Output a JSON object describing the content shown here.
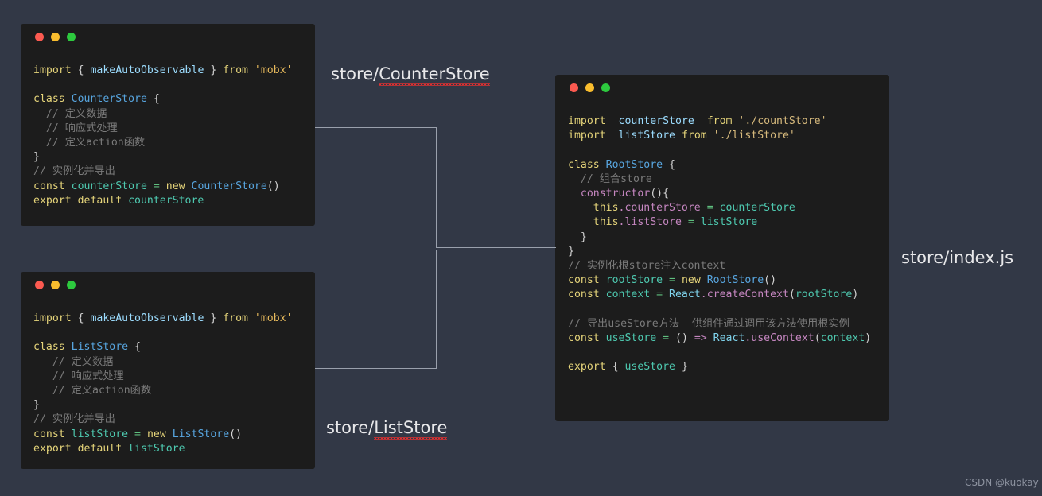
{
  "page": {
    "background_color": "#323846",
    "watermark": "CSDN @kuokay"
  },
  "window_controls": {
    "close_color": "#fb5a50",
    "minimize_color": "#f9bd2e",
    "maximize_color": "#2dc93e"
  },
  "windows": [
    {
      "id": "counter-store",
      "label": "store/CounterStore",
      "label_prefix": "store/",
      "label_name": "CounterStore",
      "label_misspelled": true,
      "code_lines": [
        [
          {
            "text": "import ",
            "cls": "t-key"
          },
          {
            "text": "{ ",
            "cls": "t-pun"
          },
          {
            "text": "makeAutoObservable",
            "cls": "t-var"
          },
          {
            "text": " } ",
            "cls": "t-pun"
          },
          {
            "text": "from ",
            "cls": "t-key"
          },
          {
            "text": "'mobx'",
            "cls": "t-str"
          }
        ],
        [],
        [
          {
            "text": "class ",
            "cls": "t-key"
          },
          {
            "text": "CounterStore",
            "cls": "t-cls"
          },
          {
            "text": " {",
            "cls": "t-pun"
          }
        ],
        [
          {
            "text": "  // 定义数据",
            "cls": "t-com"
          }
        ],
        [
          {
            "text": "  // 响应式处理",
            "cls": "t-com"
          }
        ],
        [
          {
            "text": "  // 定义action函数",
            "cls": "t-com"
          }
        ],
        [
          {
            "text": "}",
            "cls": "t-pun"
          }
        ],
        [
          {
            "text": "// 实例化并导出",
            "cls": "t-com"
          }
        ],
        [
          {
            "text": "const ",
            "cls": "t-key"
          },
          {
            "text": "counterStore",
            "cls": "t-id"
          },
          {
            "text": " = ",
            "cls": "t-op"
          },
          {
            "text": "new ",
            "cls": "t-key"
          },
          {
            "text": "CounterStore",
            "cls": "t-cls"
          },
          {
            "text": "()",
            "cls": "t-pun"
          }
        ],
        [
          {
            "text": "export default ",
            "cls": "t-key"
          },
          {
            "text": "counterStore",
            "cls": "t-id"
          }
        ]
      ]
    },
    {
      "id": "list-store",
      "label": "store/ListStore",
      "label_prefix": "store/",
      "label_name": "ListStore",
      "label_misspelled": true,
      "code_lines": [
        [
          {
            "text": "import ",
            "cls": "t-key"
          },
          {
            "text": "{ ",
            "cls": "t-pun"
          },
          {
            "text": "makeAutoObservable",
            "cls": "t-var"
          },
          {
            "text": " } ",
            "cls": "t-pun"
          },
          {
            "text": "from ",
            "cls": "t-key"
          },
          {
            "text": "'mobx'",
            "cls": "t-str"
          }
        ],
        [],
        [
          {
            "text": "class ",
            "cls": "t-key"
          },
          {
            "text": "ListStore",
            "cls": "t-cls"
          },
          {
            "text": " {",
            "cls": "t-pun"
          }
        ],
        [
          {
            "text": "   // 定义数据",
            "cls": "t-com"
          }
        ],
        [
          {
            "text": "   // 响应式处理",
            "cls": "t-com"
          }
        ],
        [
          {
            "text": "   // 定义action函数",
            "cls": "t-com"
          }
        ],
        [
          {
            "text": "}",
            "cls": "t-pun"
          }
        ],
        [
          {
            "text": "// 实例化并导出",
            "cls": "t-com"
          }
        ],
        [
          {
            "text": "const ",
            "cls": "t-key"
          },
          {
            "text": "listStore",
            "cls": "t-id"
          },
          {
            "text": " = ",
            "cls": "t-op"
          },
          {
            "text": "new ",
            "cls": "t-key"
          },
          {
            "text": "ListStore",
            "cls": "t-cls"
          },
          {
            "text": "()",
            "cls": "t-pun"
          }
        ],
        [
          {
            "text": "export default ",
            "cls": "t-key"
          },
          {
            "text": "listStore",
            "cls": "t-id"
          }
        ]
      ]
    },
    {
      "id": "index-js",
      "label": "store/index.js",
      "label_prefix": "store/",
      "label_name": "index.js",
      "label_misspelled": false,
      "code_lines": [
        [
          {
            "text": "import  ",
            "cls": "t-key"
          },
          {
            "text": "counterStore",
            "cls": "t-var"
          },
          {
            "text": "  ",
            "cls": "t-pun"
          },
          {
            "text": "from ",
            "cls": "t-key"
          },
          {
            "text": "'./countStore'",
            "cls": "t-str2"
          }
        ],
        [
          {
            "text": "import  ",
            "cls": "t-key"
          },
          {
            "text": "listStore",
            "cls": "t-var"
          },
          {
            "text": " ",
            "cls": "t-pun"
          },
          {
            "text": "from ",
            "cls": "t-key"
          },
          {
            "text": "'./listStore'",
            "cls": "t-str2"
          }
        ],
        [],
        [
          {
            "text": "class ",
            "cls": "t-key"
          },
          {
            "text": "RootStore",
            "cls": "t-cls"
          },
          {
            "text": " {",
            "cls": "t-pun"
          }
        ],
        [
          {
            "text": "  // 组合store",
            "cls": "t-com"
          }
        ],
        [
          {
            "text": "  constructor",
            "cls": "t-fn"
          },
          {
            "text": "(){",
            "cls": "t-pun"
          }
        ],
        [
          {
            "text": "    this",
            "cls": "t-key"
          },
          {
            "text": ".counterStore",
            "cls": "t-mem"
          },
          {
            "text": " = ",
            "cls": "t-op"
          },
          {
            "text": "counterStore",
            "cls": "t-id"
          }
        ],
        [
          {
            "text": "    this",
            "cls": "t-key"
          },
          {
            "text": ".listStore",
            "cls": "t-mem"
          },
          {
            "text": " = ",
            "cls": "t-op"
          },
          {
            "text": "listStore",
            "cls": "t-id"
          }
        ],
        [
          {
            "text": "  }",
            "cls": "t-pun"
          }
        ],
        [
          {
            "text": "}",
            "cls": "t-pun"
          }
        ],
        [
          {
            "text": "// 实例化根store注入context",
            "cls": "t-com"
          }
        ],
        [
          {
            "text": "const ",
            "cls": "t-key"
          },
          {
            "text": "rootStore",
            "cls": "t-id"
          },
          {
            "text": " = ",
            "cls": "t-op"
          },
          {
            "text": "new ",
            "cls": "t-key"
          },
          {
            "text": "RootStore",
            "cls": "t-cls"
          },
          {
            "text": "()",
            "cls": "t-pun"
          }
        ],
        [
          {
            "text": "const ",
            "cls": "t-key"
          },
          {
            "text": "context",
            "cls": "t-id"
          },
          {
            "text": " = ",
            "cls": "t-op"
          },
          {
            "text": "React",
            "cls": "t-obj"
          },
          {
            "text": ".createContext",
            "cls": "t-mem"
          },
          {
            "text": "(",
            "cls": "t-pun"
          },
          {
            "text": "rootStore",
            "cls": "t-id"
          },
          {
            "text": ")",
            "cls": "t-pun"
          }
        ],
        [],
        [
          {
            "text": "// 导出useStore方法  供组件通过调用该方法使用根实例",
            "cls": "t-com"
          }
        ],
        [
          {
            "text": "const ",
            "cls": "t-key"
          },
          {
            "text": "useStore",
            "cls": "t-id"
          },
          {
            "text": " = ",
            "cls": "t-op"
          },
          {
            "text": "() ",
            "cls": "t-pun"
          },
          {
            "text": "=> ",
            "cls": "t-fn"
          },
          {
            "text": "React",
            "cls": "t-obj"
          },
          {
            "text": ".useContext",
            "cls": "t-mem"
          },
          {
            "text": "(",
            "cls": "t-pun"
          },
          {
            "text": "context",
            "cls": "t-id"
          },
          {
            "text": ")",
            "cls": "t-pun"
          }
        ],
        [],
        [
          {
            "text": "export ",
            "cls": "t-key"
          },
          {
            "text": "{ ",
            "cls": "t-pun"
          },
          {
            "text": "useStore",
            "cls": "t-id"
          },
          {
            "text": " }",
            "cls": "t-pun"
          }
        ]
      ]
    }
  ],
  "connectors": {
    "line_color": "#9aa0ac",
    "description": "CounterStore and ListStore boxes connect rightward into store/index.js"
  }
}
